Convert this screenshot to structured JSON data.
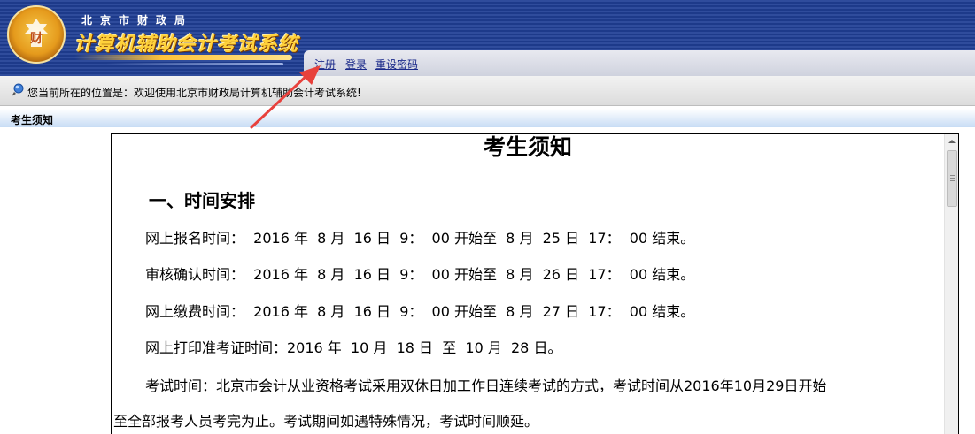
{
  "header": {
    "bureau_name": "北京市财政局",
    "system_name": "计算机辅助会计考试系统",
    "links": [
      {
        "label": "注册"
      },
      {
        "label": "登录"
      },
      {
        "label": "重设密码"
      }
    ]
  },
  "breadcrumb": {
    "text": "您当前所在的位置是：欢迎使用北京市财政局计算机辅助会计考试系统!"
  },
  "section": {
    "title": "考生须知"
  },
  "notice": {
    "title": "考生须知",
    "heading1": "一、时间安排",
    "lines": [
      "网上报名时间：  2016 年  8 月  16 日  9：  00 开始至  8 月  25 日  17：  00 结束。",
      "审核确认时间：  2016 年  8 月  16 日  9：  00 开始至  8 月  26 日  17：  00 结束。",
      "网上缴费时间：  2016 年  8 月  16 日  9：  00 开始至  8 月  27 日  17：  00 结束。",
      "网上打印准考证时间：2016 年  10 月  18 日  至  10 月  28 日。"
    ],
    "exam_time_para_1": "考试时间：北京市会计从业资格考试采用双休日加工作日连续考试的方式，考试时间从2016年10月29日开始",
    "exam_time_para_2": "至全部报考人员考完为止。考试期间如遇特殊情况，考试时间顺延。"
  },
  "icons": {
    "logo": "emblem-logo",
    "breadcrumb": "location-pin-icon",
    "scroll_up": "scroll-up-arrow-icon",
    "annotation": "red-arrow-icon"
  },
  "colors": {
    "banner_blue": "#1d3a8a",
    "title_gold": "#ffd13a",
    "link_blue": "#1b2a8a",
    "annotation_red": "#e8413c"
  }
}
